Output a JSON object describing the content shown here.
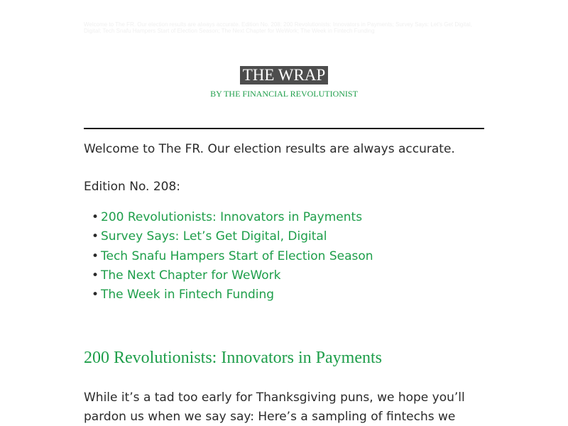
{
  "preheader": "Welcome to The FR. Our election results are always accurate. Edition No. 208: 200 Revolutionists: Innovators in Payments; Survey Says: Let's Get Digital, Digital; Tech Snafu Hampers Start of Election Season; The Next Chapter for WeWork; The Week in Fintech Funding",
  "masthead": {
    "title": "THE WRAP",
    "subtitle": "BY THE FINANCIAL REVOLUTIONIST"
  },
  "intro": {
    "welcome": "Welcome to The FR. Our election results are always accurate.",
    "edition": "Edition No. 208:"
  },
  "toc": [
    {
      "label": "200 Revolutionists: Innovators in Payments"
    },
    {
      "label": "Survey Says: Let’s Get Digital, Digital"
    },
    {
      "label": "Tech Snafu Hampers Start of Election Season"
    },
    {
      "label": "The Next Chapter for WeWork"
    },
    {
      "label": "The Week in Fintech Funding"
    }
  ],
  "bullet_glyph": "•",
  "section": {
    "heading": "200 Revolutionists: Innovators in Payments",
    "body": "While it’s a tad too early for Thanksgiving puns, we hope you’ll pardon us when we say say: Here’s a sampling of fintechs we"
  },
  "colors": {
    "accent_green": "#1e9e4a",
    "masthead_bg": "#4d4d4d",
    "text": "#2b2b2b"
  }
}
